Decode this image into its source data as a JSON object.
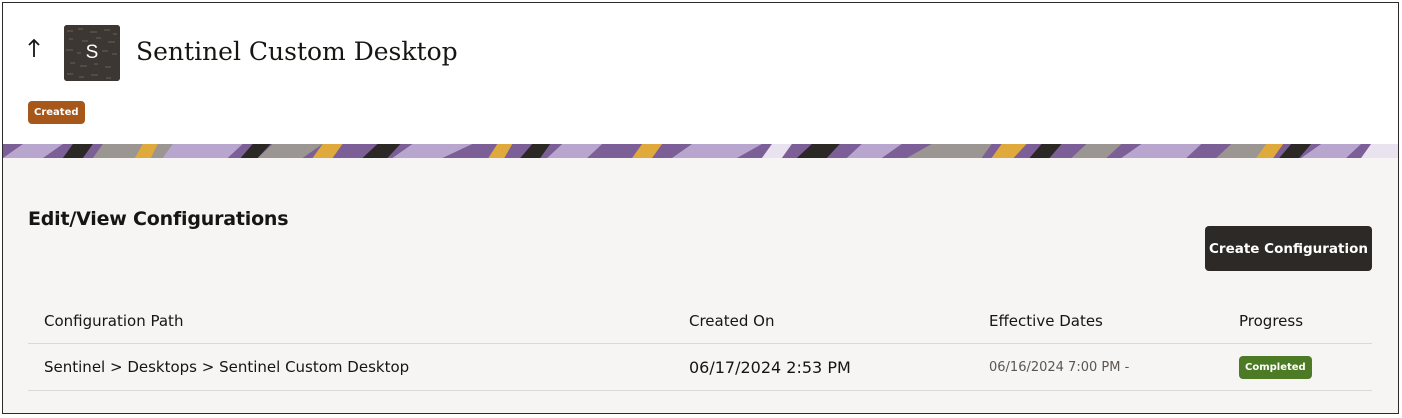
{
  "header": {
    "title": "Sentinel Custom Desktop",
    "avatar_letter": "S",
    "status": "Created",
    "back_icon": "arrow-up-icon"
  },
  "section": {
    "title": "Edit/View Configurations",
    "create_button": "Create Configuration"
  },
  "table": {
    "columns": [
      "Configuration Path",
      "Created On",
      "Effective Dates",
      "Progress"
    ],
    "rows": [
      {
        "path": "Sentinel > Desktops > Sentinel Custom Desktop",
        "created_on": "06/17/2024 2:53 PM",
        "effective_dates": "06/16/2024 7:00 PM -",
        "progress": "Completed"
      }
    ]
  },
  "colors": {
    "status_created": "#a8571a",
    "status_completed": "#4d7a25",
    "primary_button": "#2d2926",
    "banner_purple": "#7a5d92"
  }
}
